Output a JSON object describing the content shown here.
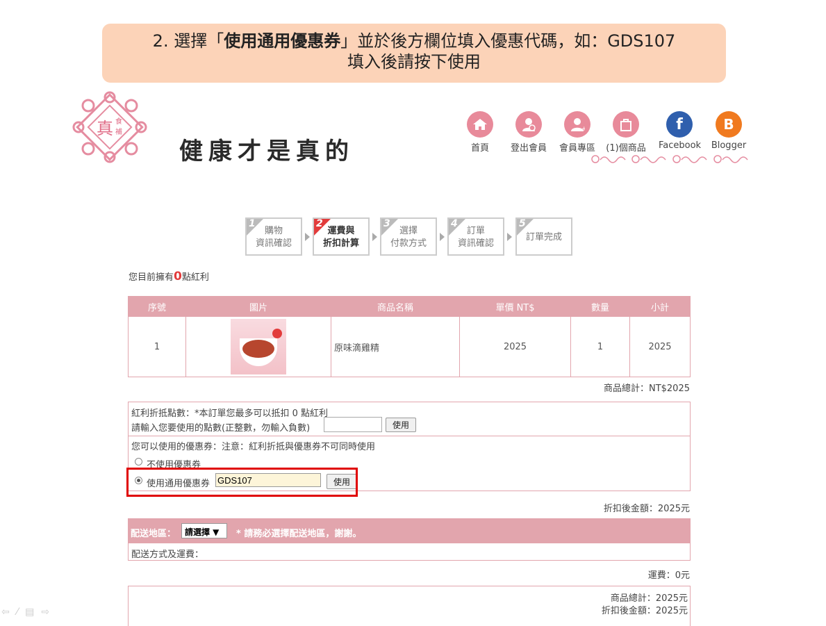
{
  "banner": {
    "line1_pre": "2. 選擇「",
    "line1_bold": "使用通用優惠券",
    "line1_post": "」並於後方欄位填入優惠代碼，如：GDS107",
    "line2": "填入後請按下使用"
  },
  "brand": {
    "slogan": "健康才是真的"
  },
  "nav": [
    {
      "label": "首頁",
      "icon": "home-icon",
      "color": "#e88a9a"
    },
    {
      "label": "登出會員",
      "icon": "logout-user-icon",
      "color": "#e88a9a"
    },
    {
      "label": "會員專區",
      "icon": "member-user-icon",
      "color": "#e88a9a"
    },
    {
      "label": "(1)個商品",
      "icon": "cart-bag-icon",
      "color": "#e88a9a"
    },
    {
      "label": "Facebook",
      "icon": "facebook-icon",
      "color": "#2f5fad"
    },
    {
      "label": "Blogger",
      "icon": "blogger-icon",
      "color": "#f07a1f"
    }
  ],
  "steps": [
    {
      "num": "1",
      "l1": "購物",
      "l2": "資訊確認"
    },
    {
      "num": "2",
      "l1": "運費與",
      "l2": "折扣計算"
    },
    {
      "num": "3",
      "l1": "選擇",
      "l2": "付款方式"
    },
    {
      "num": "4",
      "l1": "訂單",
      "l2": "資訊確認"
    },
    {
      "num": "5",
      "l1": "訂單完成",
      "l2": ""
    }
  ],
  "points": {
    "pre": "您目前擁有",
    "value": "0",
    "post": "點紅利"
  },
  "table": {
    "headers": [
      "序號",
      "圖片",
      "商品名稱",
      "單價 NT$",
      "數量",
      "小計"
    ],
    "rows": [
      {
        "no": "1",
        "name": "原味滴雞精",
        "price": "2025",
        "qty": "1",
        "subtotal": "2025"
      }
    ]
  },
  "product_total": "商品總計：NT$2025",
  "bonus": {
    "line1": "紅利折抵點數：*本訂單您最多可以抵扣 0 點紅利",
    "line2": "請輸入您要使用的點數(正整數，勿輸入負數)",
    "input_value": "",
    "button": "使用"
  },
  "coupon": {
    "note": "您可以使用的優惠券：注意：紅利折抵與優惠券不可同時使用",
    "option_none": "不使用優惠券",
    "option_general": "使用通用優惠券",
    "code": "GDS107",
    "button": "使用"
  },
  "discount_total": "折扣後金額：2025元",
  "delivery": {
    "label": "配送地區：",
    "select": "請選擇 ▼",
    "note": "* 請務必選擇配送地區，謝謝。",
    "method": "配送方式及運費："
  },
  "shipping_fee": "運費：0元",
  "summary": {
    "product_total": "商品總計：2025元",
    "discount_total": "折扣後金額：2025元"
  }
}
